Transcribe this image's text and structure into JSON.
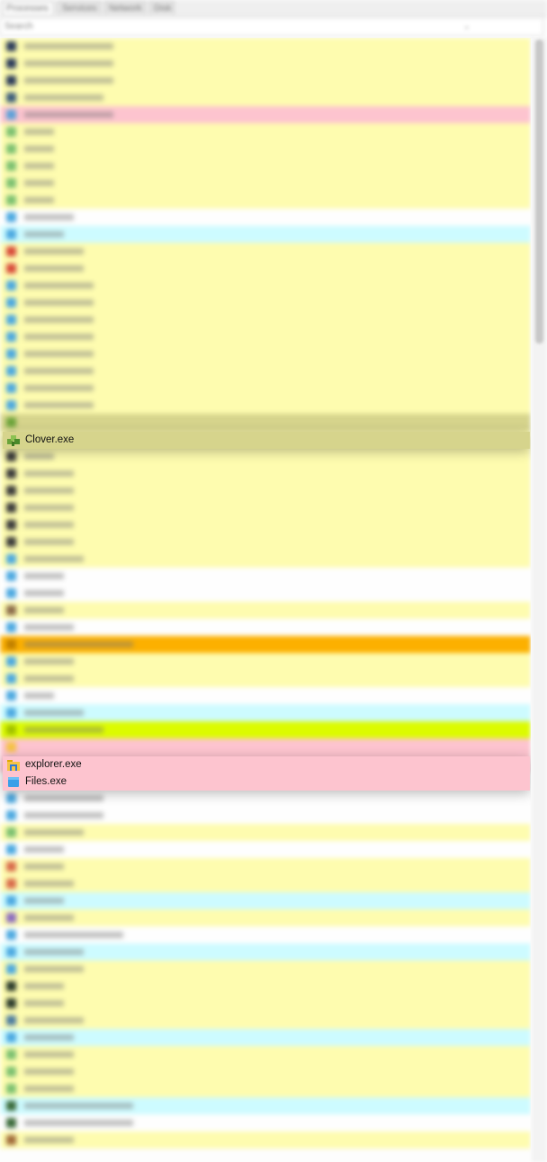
{
  "tabs": [
    {
      "label": "Processes"
    },
    {
      "label": "Services"
    },
    {
      "label": "Network"
    },
    {
      "label": "Disk"
    }
  ],
  "filter": {
    "placeholder": "Search"
  },
  "colors": {
    "yellow": "#fefcaf",
    "pink": "#fdc4cf",
    "white": "#fefefe",
    "cyan": "#cdfbff",
    "orange": "#fcb000",
    "lime": "#dcfb00",
    "olive_selected": "#d6d48c"
  },
  "processes": {
    "clover": {
      "name": "Clover.exe",
      "icon": "clover-app-icon"
    },
    "explorer": {
      "name": "explorer.exe",
      "icon": "folder-icon"
    },
    "files": {
      "name": "Files.exe",
      "icon": "files-app-icon"
    }
  }
}
